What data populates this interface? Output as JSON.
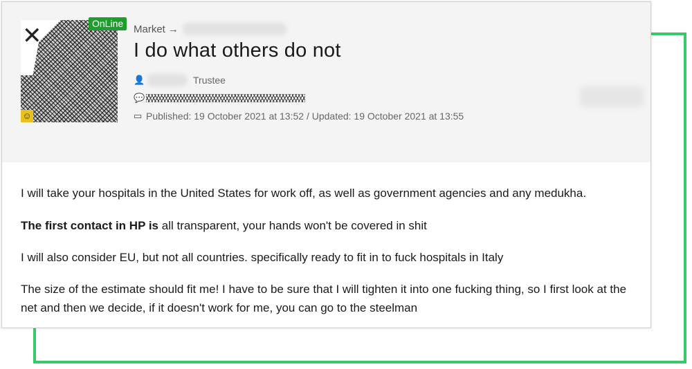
{
  "post": {
    "breadcrumb_label": "Market",
    "breadcrumb_arrow": "→",
    "title": "I do what others do not",
    "online_badge": "OnLine",
    "role": "Trustee",
    "published": "Published: 19 October 2021 at 13:52 / Updated: 19 October 2021 at 13:55",
    "icons": {
      "user": "user-icon",
      "signature": "quote-icon",
      "calendar": "calendar-icon"
    }
  },
  "body": {
    "p1": "I will take your hospitals in the United States for work off, as well as government agencies and any medukha.",
    "p2_bold": "The first contact in HP is",
    "p2_rest": " all transparent, your hands won't be covered in shit",
    "p3": "I will also consider EU, but not all countries. specifically ready to fit in to fuck hospitals in Italy",
    "p4": "The size of the estimate should fit me! I have to be sure that I will tighten it into one fucking thing, so I first look at the net and then we decide, if it doesn't work for me, you can go to the steelman"
  },
  "colors": {
    "frame": "#39c96a",
    "online": "#1f9d2d",
    "header_bg": "#f4f4f4"
  }
}
